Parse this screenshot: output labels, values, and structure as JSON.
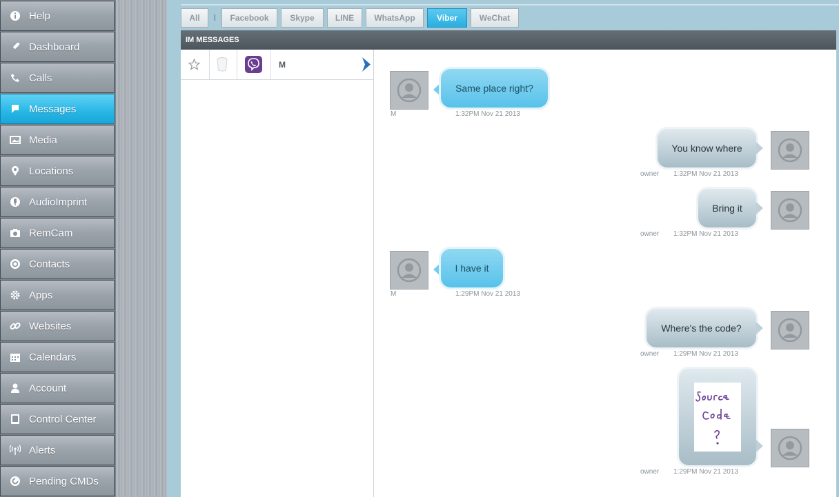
{
  "sidebar": {
    "items": [
      {
        "label": "Help",
        "icon": "info-icon"
      },
      {
        "label": "Dashboard",
        "icon": "rocket-icon"
      },
      {
        "label": "Calls",
        "icon": "phone-icon"
      },
      {
        "label": "Messages",
        "icon": "speech-bubble-icon",
        "active": true
      },
      {
        "label": "Media",
        "icon": "image-icon"
      },
      {
        "label": "Locations",
        "icon": "map-pin-icon"
      },
      {
        "label": "AudioImprint",
        "icon": "microphone-icon"
      },
      {
        "label": "RemCam",
        "icon": "camera-icon"
      },
      {
        "label": "Contacts",
        "icon": "contact-icon"
      },
      {
        "label": "Apps",
        "icon": "gear-icon"
      },
      {
        "label": "Websites",
        "icon": "link-icon"
      },
      {
        "label": "Calendars",
        "icon": "calendar-icon"
      },
      {
        "label": "Account",
        "icon": "user-icon"
      },
      {
        "label": "Control Center",
        "icon": "tablet-icon"
      },
      {
        "label": "Alerts",
        "icon": "antenna-icon"
      },
      {
        "label": "Pending CMDs",
        "icon": "pending-icon"
      }
    ]
  },
  "tabs": [
    {
      "label": "All"
    },
    {
      "label": "Facebook"
    },
    {
      "label": "Skype"
    },
    {
      "label": "LINE"
    },
    {
      "label": "WhatsApp"
    },
    {
      "label": "Viber",
      "active": true
    },
    {
      "label": "WeChat"
    }
  ],
  "panel": {
    "title": "IM MESSAGES"
  },
  "conversation": {
    "contact": "M"
  },
  "messages": [
    {
      "direction": "in",
      "text": "Same place right?",
      "sender": "M",
      "time": "1:32PM Nov 21 2013"
    },
    {
      "direction": "out",
      "text": "You know where",
      "sender": "owner",
      "time": "1:32PM Nov 21 2013"
    },
    {
      "direction": "out",
      "text": "Bring it",
      "sender": "owner",
      "time": "1:32PM Nov 21 2013"
    },
    {
      "direction": "in",
      "text": "I have it",
      "sender": "M",
      "time": "1:29PM Nov 21 2013"
    },
    {
      "direction": "out",
      "text": "Where's the code?",
      "sender": "owner",
      "time": "1:29PM Nov 21 2013"
    },
    {
      "direction": "out",
      "text": "",
      "sender": "owner",
      "time": "1:29PM Nov 21 2013",
      "attachment": "Source Code ?"
    }
  ],
  "colors": {
    "accent": "#2aaee0",
    "sidebar_active": "#28b6e6",
    "viber": "#6a3d91"
  }
}
